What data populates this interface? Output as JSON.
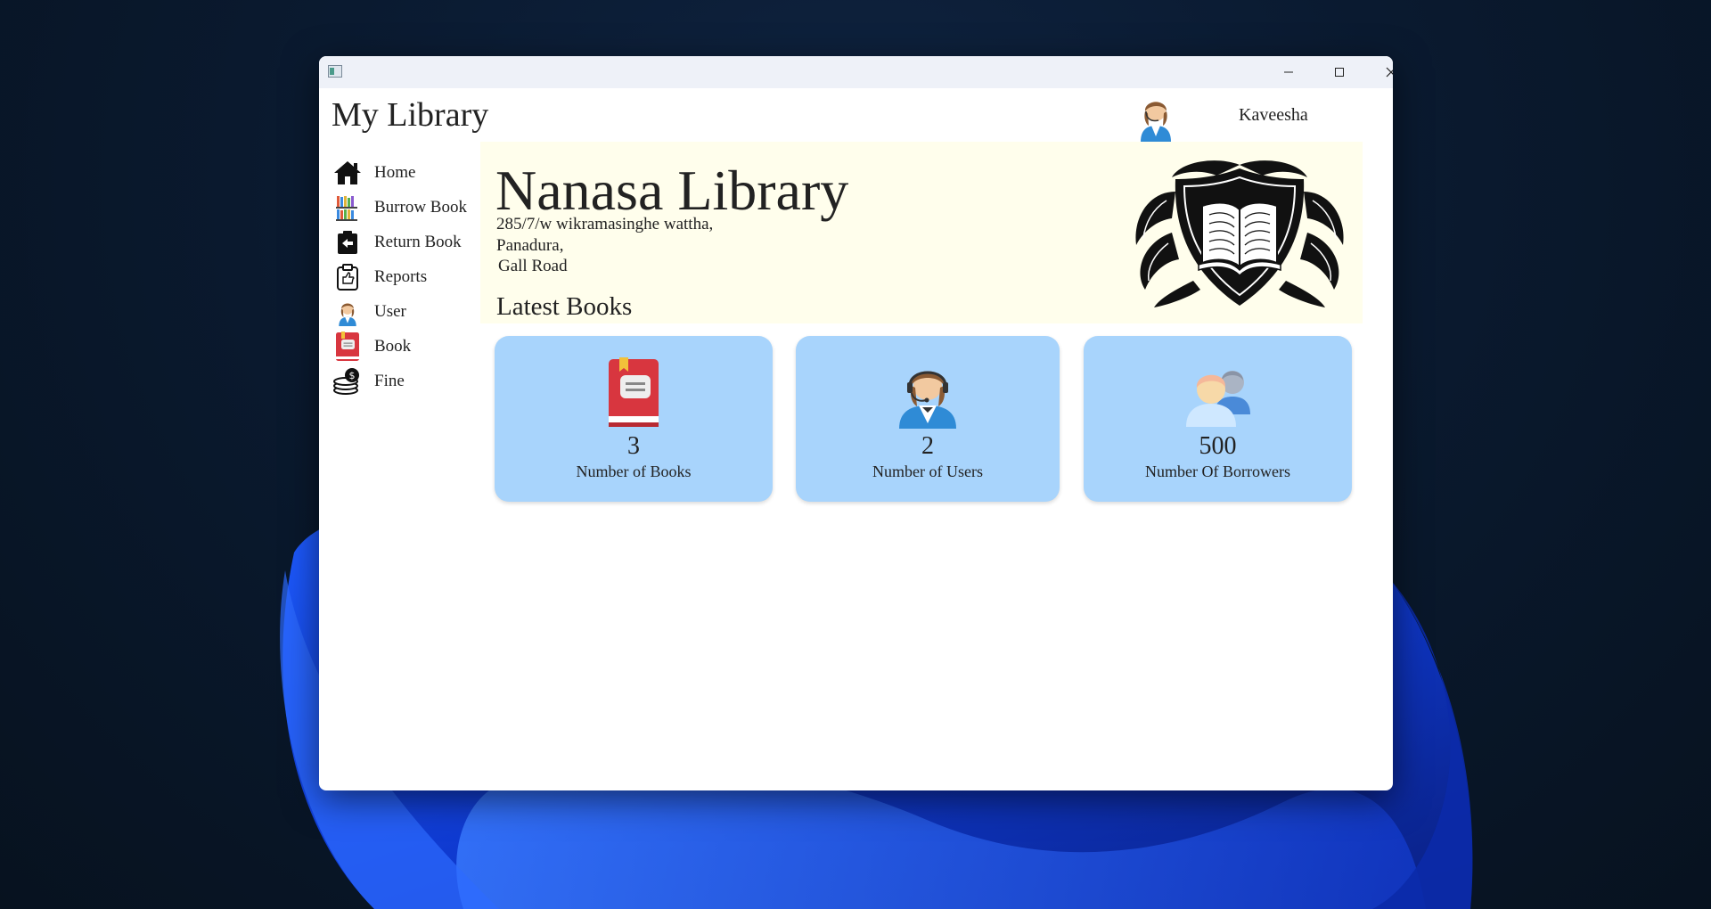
{
  "window": {
    "title": ""
  },
  "header": {
    "app_title": "My Library",
    "user_name": "Kaveesha"
  },
  "sidebar": {
    "items": [
      {
        "label": "Home",
        "icon": "home-icon"
      },
      {
        "label": "Burrow Book",
        "icon": "bookshelf-icon"
      },
      {
        "label": "Return Book",
        "icon": "return-icon"
      },
      {
        "label": "Reports",
        "icon": "clipboard-like-icon"
      },
      {
        "label": "User",
        "icon": "user-icon"
      },
      {
        "label": "Book",
        "icon": "book-icon"
      },
      {
        "label": "Fine",
        "icon": "coins-icon"
      }
    ]
  },
  "banner": {
    "library_name": "Nanasa Library",
    "address_line1": "285/7/w wikramasinghe wattha,",
    "address_line2": "Panadura,",
    "address_line3": "Gall Road",
    "section_title": "Latest Books"
  },
  "stats": [
    {
      "value": "3",
      "label": "Number of Books",
      "icon": "book-icon"
    },
    {
      "value": "2",
      "label": "Number of Users",
      "icon": "user-headset-icon"
    },
    {
      "value": "500",
      "label": "Number Of Borrowers",
      "icon": "borrowers-icon"
    }
  ],
  "colors": {
    "card_bg": "#a8d4fc",
    "banner_bg": "#fffeec",
    "titlebar_bg": "#eef1f8"
  }
}
